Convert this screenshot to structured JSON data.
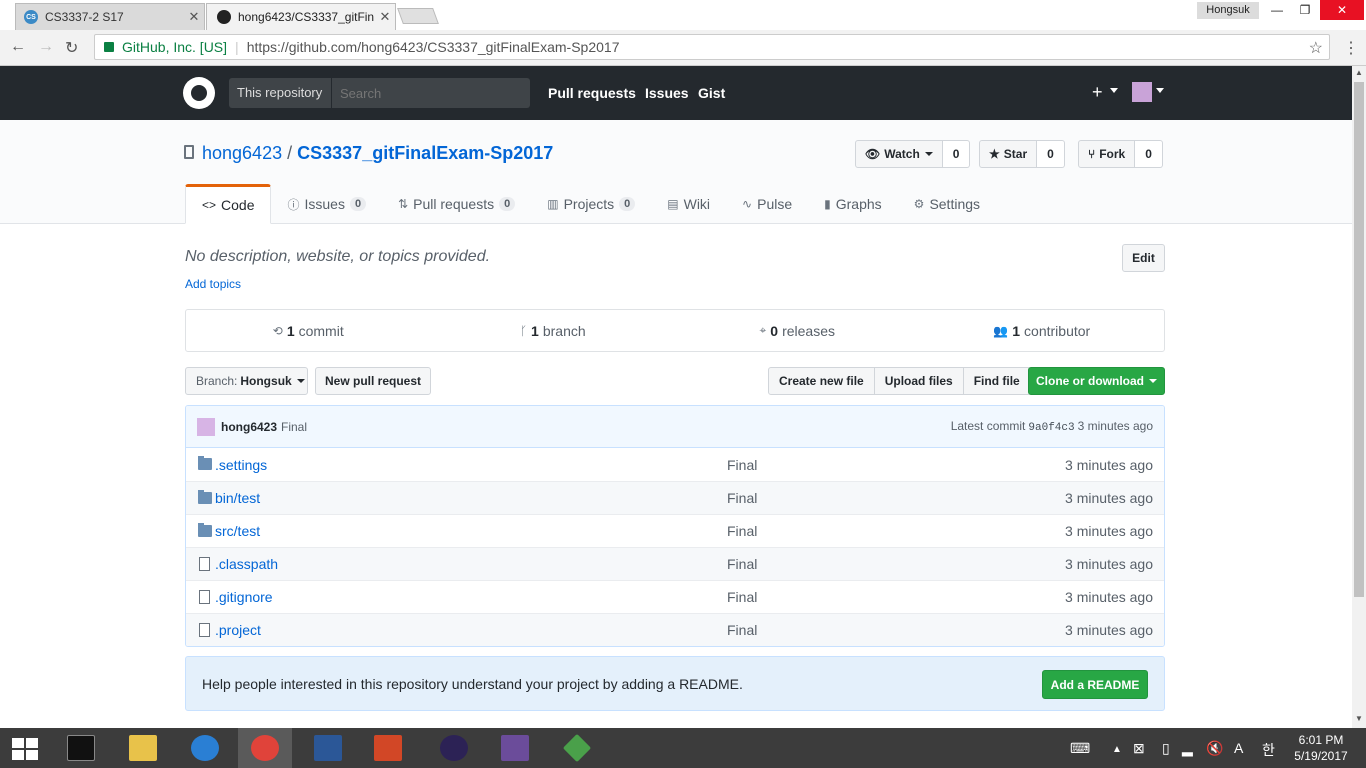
{
  "browser": {
    "tabs": [
      {
        "title": "CS3337-2 S17",
        "favicon": "CS"
      },
      {
        "title": "hong6423/CS3337_gitFin"
      }
    ],
    "profile": "Hongsuk",
    "secure_label": "GitHub, Inc. [US]",
    "url": "https://github.com/hong6423/CS3337_gitFinalExam-Sp2017"
  },
  "gh_header": {
    "scope": "This repository",
    "search_placeholder": "Search",
    "nav": [
      "Pull requests",
      "Issues",
      "Gist"
    ],
    "plus": "+"
  },
  "repo": {
    "owner": "hong6423",
    "name": "CS3337_gitFinalExam-Sp2017",
    "watch_label": "Watch",
    "watch_count": "0",
    "star_label": "Star",
    "star_count": "0",
    "fork_label": "Fork",
    "fork_count": "0"
  },
  "repo_nav": [
    {
      "label": "Code",
      "icon": "code-icon"
    },
    {
      "label": "Issues",
      "count": "0",
      "icon": "issue-icon"
    },
    {
      "label": "Pull requests",
      "count": "0",
      "icon": "pr-icon"
    },
    {
      "label": "Projects",
      "count": "0",
      "icon": "project-icon"
    },
    {
      "label": "Wiki",
      "icon": "book-icon"
    },
    {
      "label": "Pulse",
      "icon": "pulse-icon"
    },
    {
      "label": "Graphs",
      "icon": "graph-icon"
    },
    {
      "label": "Settings",
      "icon": "gear-icon"
    }
  ],
  "description": "No description, website, or topics provided.",
  "add_topics": "Add topics",
  "edit_label": "Edit",
  "summary": {
    "commits_num": "1",
    "commits_label": "commit",
    "branches_num": "1",
    "branches_label": "branch",
    "releases_num": "0",
    "releases_label": "releases",
    "contributors_num": "1",
    "contributors_label": "contributor"
  },
  "file_nav": {
    "branch_prefix": "Branch:",
    "branch": "Hongsuk",
    "new_pr": "New pull request",
    "create_file": "Create new file",
    "upload_files": "Upload files",
    "find_file": "Find file",
    "clone": "Clone or download"
  },
  "commit": {
    "author": "hong6423",
    "message": "Final",
    "latest_label": "Latest commit",
    "sha": "9a0f4c3",
    "age": "3 minutes ago"
  },
  "files": [
    {
      "type": "dir",
      "name": ".settings",
      "message": "Final",
      "age": "3 minutes ago"
    },
    {
      "type": "dir",
      "name": "bin/test",
      "message": "Final",
      "age": "3 minutes ago"
    },
    {
      "type": "dir",
      "name": "src/test",
      "message": "Final",
      "age": "3 minutes ago"
    },
    {
      "type": "file",
      "name": ".classpath",
      "message": "Final",
      "age": "3 minutes ago"
    },
    {
      "type": "file",
      "name": ".gitignore",
      "message": "Final",
      "age": "3 minutes ago"
    },
    {
      "type": "file",
      "name": ".project",
      "message": "Final",
      "age": "3 minutes ago"
    }
  ],
  "readme_prompt": "Help people interested in this repository understand your project by adding a README.",
  "readme_button": "Add a README",
  "taskbar": {
    "time": "6:01 PM",
    "date": "5/19/2017"
  }
}
